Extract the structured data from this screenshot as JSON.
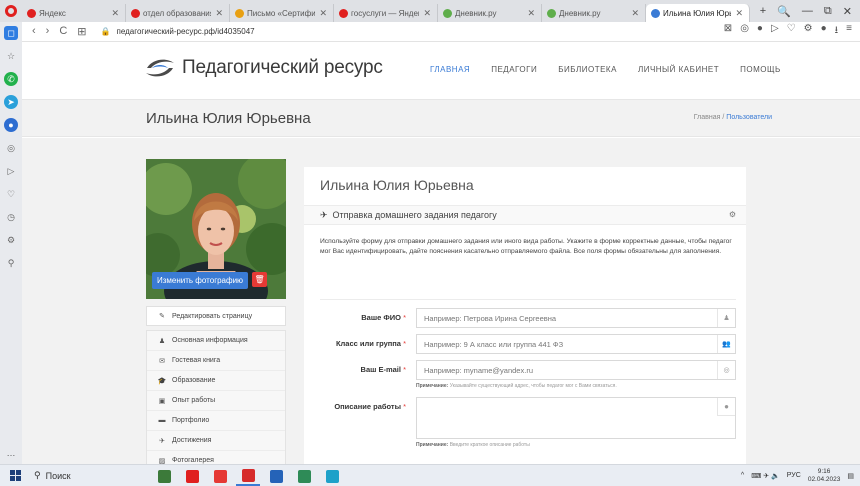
{
  "browser": {
    "tabs": [
      {
        "label": "Яндекс",
        "color": "#e0201f",
        "width": 104
      },
      {
        "label": "отдел образования цине",
        "color": "#e0201f",
        "width": 104
      },
      {
        "label": "Письмо «Сертификат Ил",
        "color": "#e8a013",
        "width": 104
      },
      {
        "label": "госуслуги — Яндекс нашл",
        "color": "#e0201f",
        "width": 104
      },
      {
        "label": "Дневник.ру",
        "color": "#5fae4b",
        "width": 104
      },
      {
        "label": "Дневник.ру",
        "color": "#5fae4b",
        "width": 104
      },
      {
        "label": "Ильина Юлия Юрьевна —",
        "color": "#3a7bd5",
        "width": 104,
        "active": true
      }
    ],
    "window_controls": [
      "+",
      "🔍",
      "—",
      "⧉",
      "✕"
    ],
    "url": "педагогический-ресурс.рф/id4035047",
    "nav": [
      "‹",
      "›",
      "C",
      "⊞"
    ],
    "addr_icons": [
      "⊠",
      "◎",
      "●",
      "▷",
      "♡",
      "⚙",
      "●",
      "⭳",
      "≡"
    ],
    "sidebar_icons": [
      {
        "name": "opera-home-icon",
        "glyph": "◻",
        "cls": "blue"
      },
      {
        "name": "bookmark-icon",
        "glyph": "☆",
        "cls": ""
      },
      {
        "name": "whatsapp-icon",
        "glyph": "✆",
        "cls": "green"
      },
      {
        "name": "telegram-icon",
        "glyph": "➤",
        "cls": "tg"
      },
      {
        "name": "vk-icon",
        "glyph": "●",
        "cls": "vk"
      },
      {
        "name": "player-icon",
        "glyph": "◎",
        "cls": ""
      },
      {
        "name": "flow-icon",
        "glyph": "▷",
        "cls": ""
      },
      {
        "name": "heart-icon",
        "glyph": "♡",
        "cls": ""
      },
      {
        "name": "history-icon",
        "glyph": "◷",
        "cls": ""
      },
      {
        "name": "settings-icon",
        "glyph": "⚙",
        "cls": ""
      },
      {
        "name": "location-icon",
        "glyph": "⚲",
        "cls": ""
      }
    ],
    "sidebar_more": "…"
  },
  "site": {
    "logo": "Педагогический ресурс",
    "nav": [
      "ГЛАВНАЯ",
      "ПЕДАГОГИ",
      "БИБЛИОТЕКА",
      "ЛИЧНЫЙ КАБИНЕТ",
      "ПОМОЩЬ"
    ],
    "page_title": "Ильина Юлия Юрьевна",
    "breadcrumb": {
      "home": "Главная",
      "sep": "/",
      "current": "Пользователи"
    }
  },
  "profile": {
    "change_photo": "Изменить фотографию",
    "delete_icon": "🗑",
    "menu_first": {
      "icon": "✎",
      "label": "Редактировать страницу"
    },
    "menu": [
      {
        "icon": "♟",
        "label": "Основная информация"
      },
      {
        "icon": "✉",
        "label": "Гостевая книга"
      },
      {
        "icon": "🎓",
        "label": "Образование"
      },
      {
        "icon": "▣",
        "label": "Опыт работы"
      },
      {
        "icon": "▬",
        "label": "Портфолио"
      },
      {
        "icon": "✈",
        "label": "Достижения"
      },
      {
        "icon": "▨",
        "label": "Фотогалерея"
      }
    ]
  },
  "card": {
    "name": "Ильина Юлия Юрьевна",
    "section_icon": "✈",
    "section_title": "Отправка домашнего задания педагогу",
    "gear": "⚙",
    "description": "Используйте форму для отправки домашнего задания или иного вида работы. Укажите в форме корректные данные, чтобы педагог мог Вас идентифицировать, дайте пояснения касательно отправляемого файла. Все поля формы обязательны для заполнения.",
    "form": {
      "fio": {
        "label": "Ваше ФИО",
        "req": "*",
        "placeholder": "Например: Петрова Ирина Сергеевна",
        "icon": "♟"
      },
      "class": {
        "label": "Класс или группа",
        "req": "*",
        "placeholder": "Например: 9 А класс или группа 441 ФЗ",
        "icon": "👥"
      },
      "email": {
        "label": "Ваш E-mail",
        "req": "*",
        "placeholder": "Например: myname@yandex.ru",
        "icon": "◎",
        "note_b": "Примечание:",
        "note": " Указывайте существующий адрес, чтобы педагог мог с Вами связаться."
      },
      "desc": {
        "label": "Описание работы",
        "req": "*",
        "icon": "●",
        "note_b": "Примечание:",
        "note": " Введите краткое описание работы"
      }
    }
  },
  "taskbar": {
    "search": "Поиск",
    "search_icon": "⚲",
    "apps": [
      {
        "name": "landscape-app-icon",
        "color": "#3c7a3a"
      },
      {
        "name": "yandex-app-icon",
        "color": "#e0201f"
      },
      {
        "name": "files-app-icon",
        "color": "#e53935"
      },
      {
        "name": "opera-app-icon",
        "color": "#d62b2b"
      },
      {
        "name": "outlook-app-icon",
        "color": "#2563b8"
      },
      {
        "name": "explorer-app-icon",
        "color": "#2e8b57"
      },
      {
        "name": "edge-app-icon",
        "color": "#1ea1c9"
      }
    ],
    "tray": {
      "arrow": "^",
      "icons": "⌨ ✈ 🔈",
      "lang": "РУС",
      "time": "9:16",
      "date": "02.04.2023"
    }
  }
}
